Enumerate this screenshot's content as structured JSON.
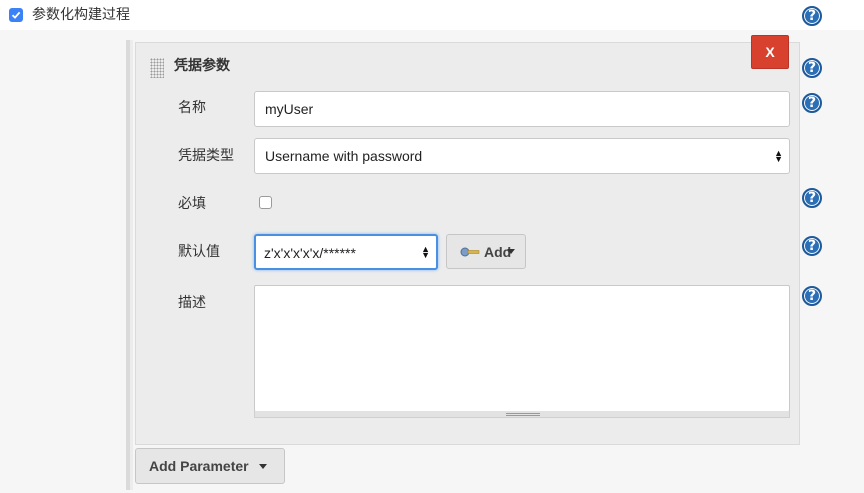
{
  "build_option": {
    "label": "参数化构建过程",
    "checked": true
  },
  "parameter_panel": {
    "title": "凭据参数",
    "delete_label": "X",
    "fields": {
      "name_label": "名称",
      "name_value": "myUser",
      "type_label": "凭据类型",
      "type_value": "Username with password",
      "required_label": "必填",
      "required_checked": false,
      "default_label": "默认值",
      "default_value": "z'x'x'x'x'x/******",
      "add_label": "Add",
      "description_label": "描述",
      "description_value": ""
    }
  },
  "add_parameter_label": "Add Parameter",
  "help_glyph": "?",
  "icons": [
    "checkbox-checked-icon",
    "help-icon",
    "drag-handle-icon",
    "key-icon",
    "select-arrows-icon",
    "caret-down-icon"
  ],
  "colors": {
    "help": "#2b6fb6",
    "delete": "#d9412f",
    "focus": "#4a90e2",
    "checkbox": "#3b82f6"
  }
}
